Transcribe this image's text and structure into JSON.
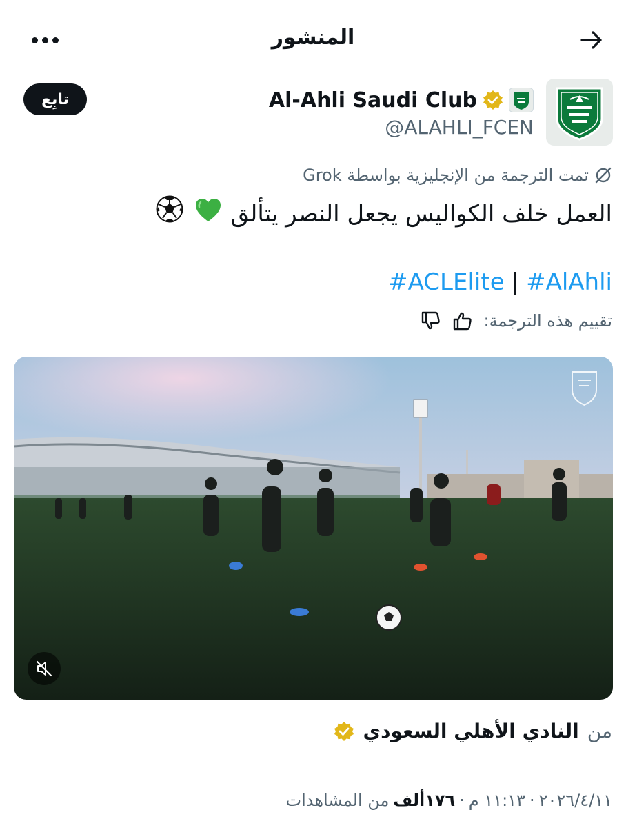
{
  "header": {
    "title": "المنشور",
    "back_icon": "arrow-right-icon",
    "more_icon": "more-dots-icon"
  },
  "author": {
    "display_name": "Al-Ahli Saudi Club",
    "handle": "@ALAHLI_FCEN",
    "follow_label": "تابِع",
    "verified_color": "#e2b719",
    "brand_color": "#0b7a3b"
  },
  "translation": {
    "note": "تمت الترجمة من الإنجليزية بواسطة Grok",
    "rate_label": "تقييم هذه الترجمة:"
  },
  "tweet": {
    "text": "العمل خلف الكواليس يجعل النصر يتألق",
    "emoji_heart": "💚",
    "emoji_ball": "⚽",
    "hashtag_1": "#AlAhli",
    "separator": "|",
    "hashtag_2": "#ACLElite"
  },
  "source": {
    "from_label": "من",
    "name": "النادي الأهلي السعودي"
  },
  "meta": {
    "date": "٢٠٢٦/٤/١١",
    "dot": "·",
    "time": "١١:١٣ م",
    "views": "١٧٦ألف",
    "views_label": "من المشاهدات"
  },
  "colors": {
    "link": "#1d9bf0",
    "muted": "#536471"
  }
}
